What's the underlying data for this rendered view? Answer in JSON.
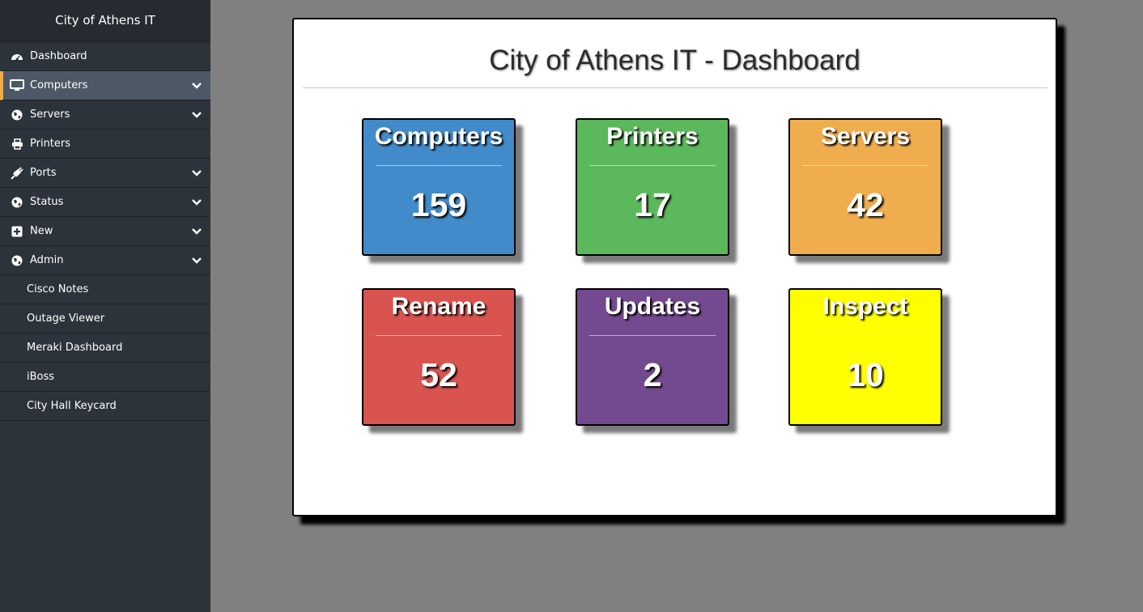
{
  "sidebar": {
    "brand": "City of Athens IT",
    "items": [
      {
        "label": "Dashboard",
        "icon": "dashboard-icon"
      },
      {
        "label": "Computers",
        "icon": "monitor-icon",
        "active": true
      },
      {
        "label": "Servers",
        "icon": "globe-icon"
      },
      {
        "label": "Printers",
        "icon": "printer-icon"
      },
      {
        "label": "Ports",
        "icon": "plug-icon"
      },
      {
        "label": "Status",
        "icon": "globe-icon"
      },
      {
        "label": "New",
        "icon": "plus-square-icon"
      },
      {
        "label": "Admin",
        "icon": "globe-icon"
      }
    ],
    "subitems": [
      {
        "label": "Cisco Notes"
      },
      {
        "label": "Outage Viewer"
      },
      {
        "label": "Meraki Dashboard"
      },
      {
        "label": "iBoss"
      },
      {
        "label": "City Hall Keycard"
      }
    ]
  },
  "main": {
    "title": "City of Athens IT - Dashboard",
    "tiles": [
      {
        "label": "Computers",
        "count": "159",
        "color": "#428bca"
      },
      {
        "label": "Printers",
        "count": "17",
        "color": "#5cb85c"
      },
      {
        "label": "Servers",
        "count": "42",
        "color": "#f0ad4e"
      },
      {
        "label": "Rename",
        "count": "52",
        "color": "#d9534f"
      },
      {
        "label": "Updates",
        "count": "2",
        "color": "#734a8f"
      },
      {
        "label": "Inspect",
        "count": "10",
        "color": "#ffff00"
      }
    ]
  },
  "colors": {
    "sidebar_bg": "#2d333b",
    "active_accent": "#f0ad4e",
    "page_bg": "#808080"
  }
}
